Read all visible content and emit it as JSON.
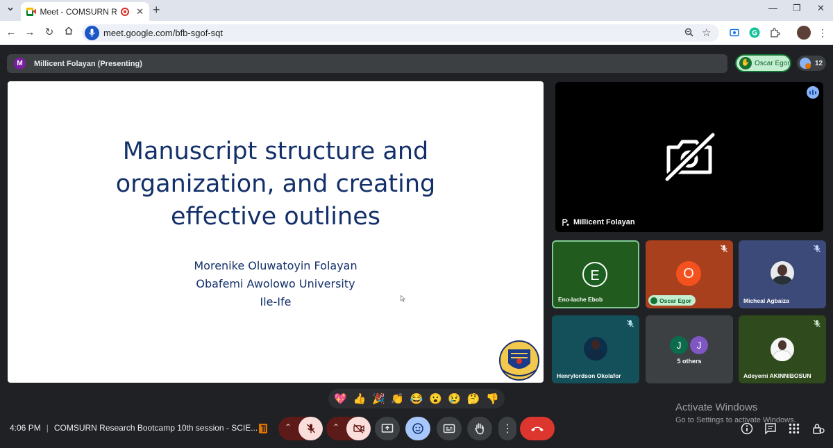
{
  "browser": {
    "tab_title": "Meet - COMSURN Research",
    "url": "meet.google.com/bfb-sgof-sqt"
  },
  "meet": {
    "presenting_avatar": "M",
    "presenting_label": "Millicent Folayan (Presenting)",
    "raised_hand_name": "Oscar Egor",
    "participant_count": "12",
    "slide": {
      "title_lines": [
        "Manuscript structure and",
        "organization, and creating",
        "effective outlines"
      ],
      "author_lines": [
        "Morenike Oluwatoyin Folayan",
        "Obafemi Awolowo University",
        "Ile-Ife"
      ]
    },
    "main_tile_name": "Millicent Folayan",
    "tiles": [
      {
        "name": "Eno-lache Ebob",
        "initial": "E",
        "bg": "#215c1e",
        "avatar": "#1b5e20"
      },
      {
        "name": "Oscar Egor",
        "initial": "O",
        "bg": "#a8401e",
        "avatar": "#f4511e"
      },
      {
        "name": "Micheal Agbaiza",
        "bg": "#3c4a7a"
      },
      {
        "name": "Henrylordson Okolafor",
        "bg": "#14505a"
      },
      {
        "name": "5 others",
        "initials": [
          "J",
          "J"
        ],
        "bg": "#3c4043"
      },
      {
        "name": "Adeyemi AKINNIBOSUN",
        "bg": "#2f4a1c"
      }
    ],
    "reactions": [
      "💖",
      "👍",
      "🎉",
      "👏",
      "😂",
      "😮",
      "😢",
      "🤔",
      "👎"
    ],
    "time": "4:06 PM",
    "meeting_title": "COMSURN Research Bootcamp 10th session - SCIE...",
    "watermark_title": "Activate Windows",
    "watermark_sub": "Go to Settings to activate Windows."
  }
}
